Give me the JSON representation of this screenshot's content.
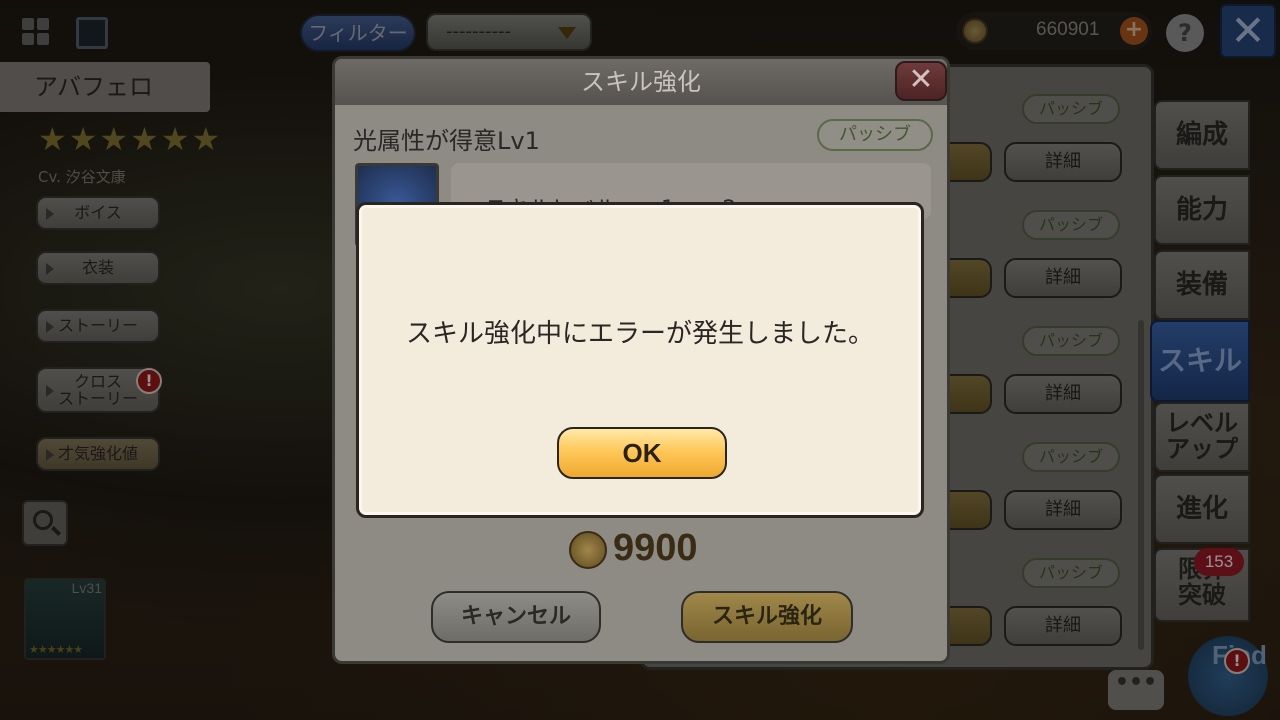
{
  "top_bar": {
    "filter_label": "フィルター",
    "filter_select_value": "----------",
    "currency_value": "660901",
    "plus_label": "+",
    "help_label": "?",
    "close_label": "✕"
  },
  "character": {
    "name": "アバフェロ",
    "stars": "★★★★★★",
    "cv": "Cv. 汐谷文康",
    "portrait_level": "Lv31",
    "portrait_stars": "★★★★★★"
  },
  "side_buttons": {
    "voice": "ボイス",
    "costume": "衣装",
    "story": "ストーリー",
    "cross_story_line1": "クロス",
    "cross_story_line2": "ストーリー",
    "talent": "才気強化値",
    "alert": "!"
  },
  "skill_list": {
    "passive_label": "パッシブ",
    "detail_label": "詳細"
  },
  "right_tabs": {
    "formation": "編成",
    "ability": "能力",
    "equipment": "装備",
    "skill": "スキル",
    "levelup_line1": "レベル",
    "levelup_line2": "アップ",
    "evolution": "進化",
    "limit_line1": "限界",
    "limit_line2": "突破",
    "limit_badge": "153",
    "chat": "•••",
    "find_text": "Find",
    "find_alert": "!"
  },
  "enhance_dialog": {
    "title": "スキル強化",
    "close_label": "✕",
    "skill_name": "光属性が得意Lv1",
    "passive_label": "パッシブ",
    "level_label": "スキルレベル　　1　➡ 2",
    "cost_value": "9900",
    "cancel_label": "キャンセル",
    "confirm_label": "スキル強化"
  },
  "error_modal": {
    "message": "スキル強化中にエラーが発生しました。",
    "ok_label": "OK"
  }
}
